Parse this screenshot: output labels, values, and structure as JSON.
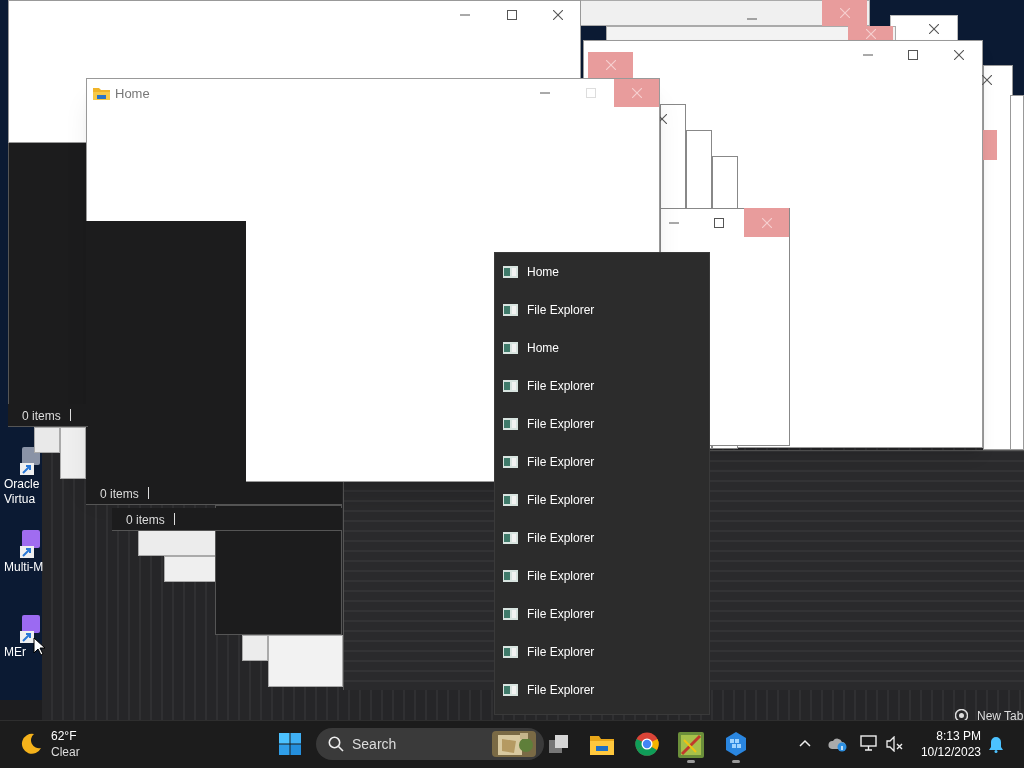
{
  "desktop_icons": [
    {
      "label": "Oracle Virtua"
    },
    {
      "label": "Multi-M"
    },
    {
      "label": "MEr"
    }
  ],
  "home_window": {
    "title": "Home"
  },
  "status_bars": [
    "0 items",
    "0 items",
    "0 items"
  ],
  "jump_list": {
    "items": [
      {
        "label": "Home"
      },
      {
        "label": "File Explorer"
      },
      {
        "label": "Home"
      },
      {
        "label": "File Explorer"
      },
      {
        "label": "File Explorer"
      },
      {
        "label": "File Explorer"
      },
      {
        "label": "File Explorer"
      },
      {
        "label": "File Explorer"
      },
      {
        "label": "File Explorer"
      },
      {
        "label": "File Explorer"
      },
      {
        "label": "File Explorer"
      },
      {
        "label": "File Explorer"
      }
    ]
  },
  "taskbar": {
    "preview_label": "New Tab",
    "weather": {
      "temperature": "62°F",
      "condition": "Clear"
    },
    "search": {
      "placeholder": "Search"
    },
    "clock": {
      "time": "8:13 PM",
      "date": "10/12/2023"
    }
  }
}
